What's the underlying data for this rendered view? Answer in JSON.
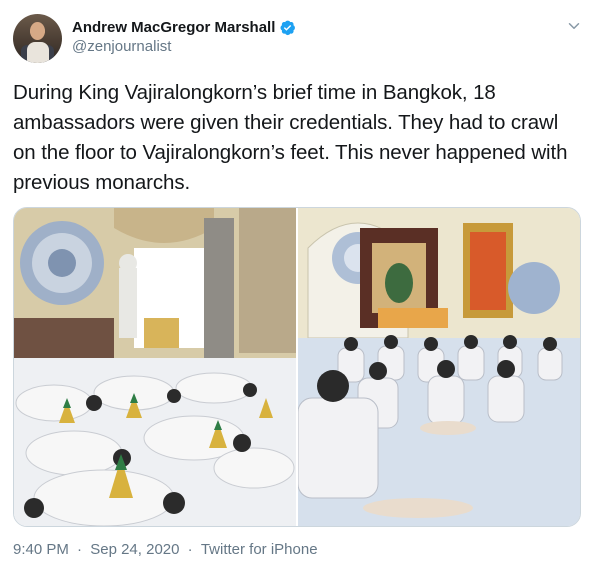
{
  "author": {
    "display_name": "Andrew MacGregor Marshall",
    "handle": "@zenjournalist",
    "verified": true
  },
  "tweet": {
    "text": "During King Vajiralongkorn’s brief time in Bangkok, 18 ambassadors were given their credentials. They had to crawl on the floor to Vajiralongkorn’s feet. This never happened with previous monarchs.",
    "time": "9:40 PM",
    "date": "Sep 24, 2020",
    "separator": "·",
    "source": "Twitter for iPhone"
  },
  "icons": {
    "verified": "verified-badge-icon",
    "caret": "chevron-down-icon"
  },
  "colors": {
    "verified_blue": "#1da1f2",
    "secondary_text": "#657786",
    "primary_text": "#14171a"
  }
}
